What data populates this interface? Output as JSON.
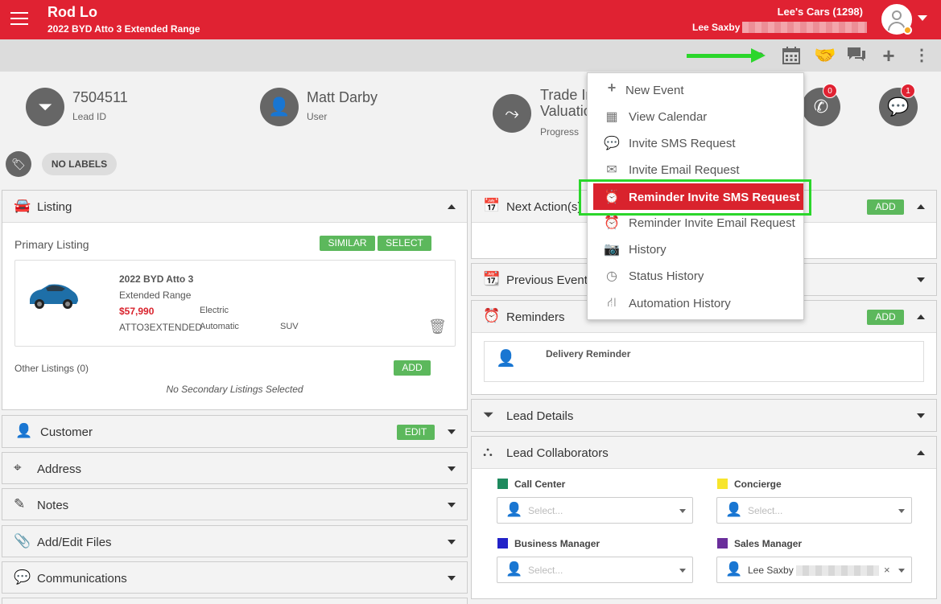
{
  "header": {
    "title": "Rod Lo",
    "subtitle": "2022 BYD Atto 3 Extended Range",
    "dealer": "Lee's Cars (1298)",
    "staff": "Lee Saxby"
  },
  "stats": {
    "lead_id_value": "7504511",
    "lead_id_label": "Lead ID",
    "user_value": "Matt Darby",
    "user_label": "User",
    "progress_value_line1": "Trade In",
    "progress_value_line2": "Valuation",
    "progress_label": "Progress",
    "calls_badge": "0",
    "messages_badge": "1"
  },
  "labels": {
    "no_labels": "NO LABELS"
  },
  "listing": {
    "title": "Listing",
    "primary_label": "Primary Listing",
    "similar_btn": "SIMILAR",
    "select_btn": "SELECT",
    "car_title": "2022 BYD Atto 3",
    "car_variant": "Extended Range",
    "price": "$57,990",
    "fuel": "Electric",
    "stock": "ATTO3EXTENDED",
    "transmission": "Automatic",
    "body": "SUV",
    "other_label": "Other Listings (0)",
    "add_btn": "ADD",
    "empty_text": "No Secondary Listings Selected"
  },
  "left_sections": {
    "customer": "Customer",
    "customer_edit": "EDIT",
    "address": "Address",
    "notes": "Notes",
    "files": "Add/Edit Files",
    "communications": "Communications"
  },
  "right_sections": {
    "next_actions": "Next Action(s)",
    "next_add": "ADD",
    "previous_events": "Previous Events",
    "reminders": "Reminders",
    "reminders_add": "ADD",
    "reminder_item": "Delivery Reminder",
    "lead_details": "Lead Details",
    "lead_collaborators": "Lead Collaborators"
  },
  "collaborators": {
    "call_center": "Call Center",
    "concierge": "Concierge",
    "business_manager": "Business Manager",
    "sales_manager": "Sales Manager",
    "placeholder": "Select...",
    "sales_manager_value": "Lee Saxby",
    "colors": {
      "call_center": "#1e8a5e",
      "concierge": "#f7e52c",
      "business_manager": "#2222c8",
      "sales_manager": "#6a2e9b"
    }
  },
  "menu": {
    "items": [
      {
        "label": "New Event",
        "icon": "plus-icon"
      },
      {
        "label": "View Calendar",
        "icon": "calendar-icon"
      },
      {
        "label": "Invite SMS Request",
        "icon": "chat-icon"
      },
      {
        "label": "Invite Email Request",
        "icon": "envelope-icon"
      },
      {
        "label": "Reminder Invite SMS Request",
        "icon": "alarm-icon"
      },
      {
        "label": "Reminder Invite Email Request",
        "icon": "alarm-icon"
      },
      {
        "label": "History",
        "icon": "camera-icon"
      },
      {
        "label": "Status History",
        "icon": "history-icon"
      },
      {
        "label": "Automation History",
        "icon": "sitemap-icon"
      }
    ]
  }
}
